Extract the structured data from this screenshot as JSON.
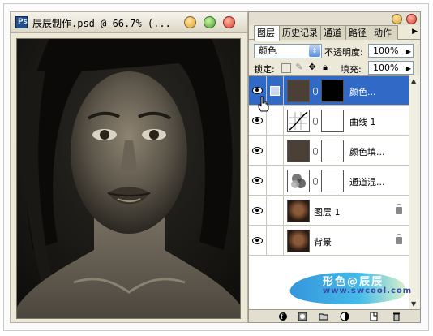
{
  "document": {
    "title": "辰辰制作.psd @ 66.7% (...",
    "app_icon": "Ps"
  },
  "palette": {
    "tabs": [
      {
        "label": "图层",
        "active": true
      },
      {
        "label": "历史记录",
        "active": false
      },
      {
        "label": "通道",
        "active": false
      },
      {
        "label": "路径",
        "active": false
      },
      {
        "label": "动作",
        "active": false
      }
    ],
    "blend_mode": "颜色",
    "opacity_label": "不透明度:",
    "opacity_value": "100%",
    "lock_label": "锁定:",
    "fill_label": "填充:",
    "fill_value": "100%",
    "layers": [
      {
        "name": "颜色...",
        "selected": true,
        "thumb": "color-fill",
        "has_mask": true,
        "mask": "black",
        "locked": false
      },
      {
        "name": "曲线 1",
        "selected": false,
        "thumb": "curves",
        "has_mask": true,
        "mask": "white",
        "locked": false
      },
      {
        "name": "颜色填...",
        "selected": false,
        "thumb": "color-fill",
        "has_mask": true,
        "mask": "white",
        "locked": false
      },
      {
        "name": "通道混...",
        "selected": false,
        "thumb": "channel-mixer",
        "has_mask": true,
        "mask": "white",
        "locked": false
      },
      {
        "name": "图层 1",
        "selected": false,
        "thumb": "photo",
        "has_mask": false,
        "locked": true
      },
      {
        "name": "背景",
        "selected": false,
        "thumb": "photo",
        "has_mask": false,
        "locked": true
      }
    ]
  },
  "watermark": {
    "line1": "形色@辰辰",
    "line2": "www.swcool.com"
  },
  "colors": {
    "selection": "#3169c6",
    "fill_layer": "#4a4036",
    "panel_bg": "#ece9d8"
  }
}
